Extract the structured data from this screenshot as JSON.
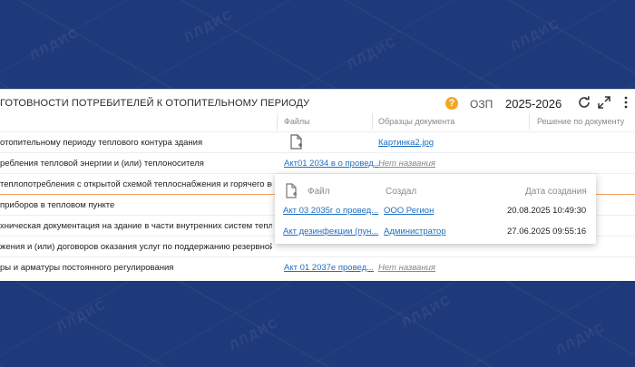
{
  "header": {
    "title": "ГОТОВНОСТИ ПОТРЕБИТЕЛЕЙ К ОТОПИТЕЛЬНОМУ ПЕРИОДУ",
    "help_symbol": "?",
    "ozp_label": "ОЗП",
    "year": "2025-2026"
  },
  "columns": {
    "files": "Файлы",
    "samples": "Образцы документа",
    "decision": "Решение по документу"
  },
  "rows": [
    {
      "text": "отопительному периоду теплового контура здания",
      "file": "",
      "sample": "Картинка2.jpg",
      "sample_empty": ""
    },
    {
      "text": "ребления тепловой энергии и (или) теплоносителя",
      "file": "Акт01 2034 в о провед...",
      "sample": "",
      "sample_empty": "Нет названия"
    },
    {
      "text": "теплопотребления с открытой схемой теплоснабжения и горячего водо",
      "file": "",
      "sample": "",
      "sample_empty": ""
    },
    {
      "text": "приборов в тепловом пункте",
      "file": "",
      "sample": "",
      "sample_empty": ""
    },
    {
      "text": "хническая документация на здание в части внутренних систем тепл",
      "file": "",
      "sample": "",
      "sample_empty": ""
    },
    {
      "text": "жения и (или) договоров оказания услуг по поддержанию резервной",
      "file": "",
      "sample": "",
      "sample_empty": ""
    },
    {
      "text": "ры и арматуры постоянного регулирования",
      "file": "Акт 01 2037е провед...",
      "sample": "",
      "sample_empty": "Нет названия"
    }
  ],
  "popup": {
    "head_file": "Файл",
    "head_created": "Создал",
    "head_date": "Дата создания",
    "items": [
      {
        "file": "Акт 03 2035г о провед...",
        "author": "ООО Регион",
        "date": "20.08.2025 10:49:30"
      },
      {
        "file": "Акт дезинфекции (пун...",
        "author": "Администратор",
        "date": "27.06.2025 09:55:16"
      }
    ]
  },
  "watermark_text": "ЛЛДИС",
  "colors": {
    "background": "#1f3a7a",
    "link": "#1f6fc1",
    "help": "#f2a724",
    "divider_accent": "#f5a25c"
  }
}
